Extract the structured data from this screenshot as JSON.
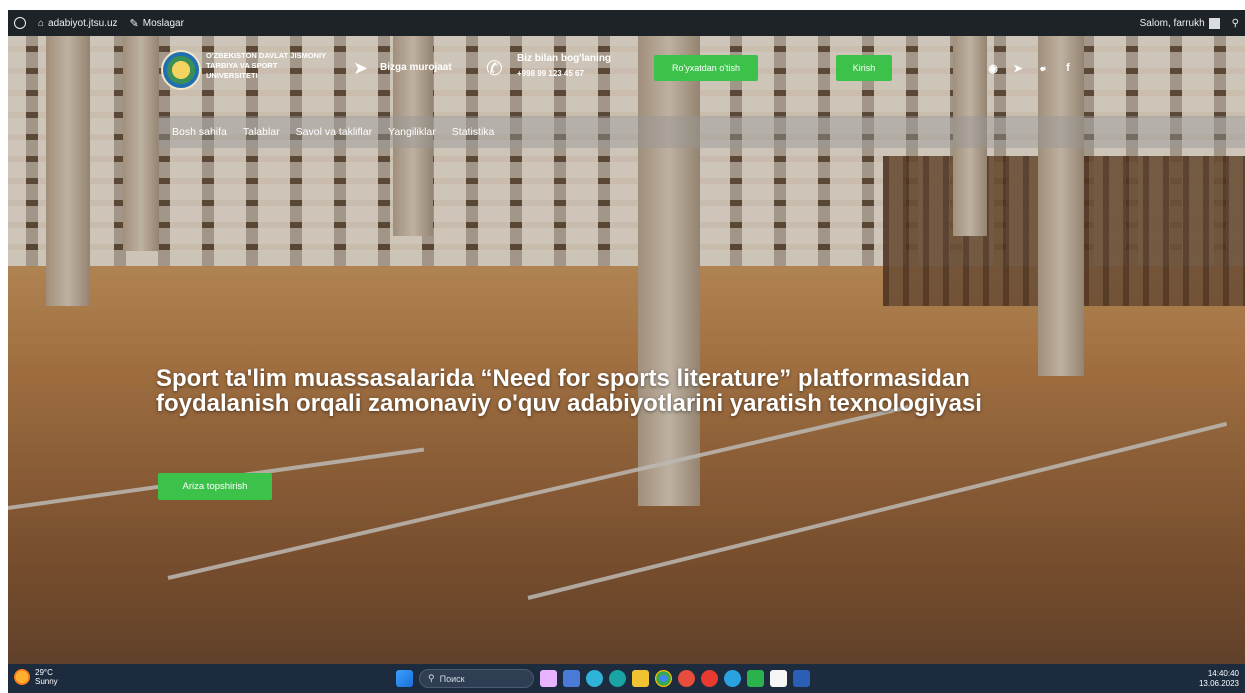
{
  "adminbar": {
    "wp_logo_icon": "wordpress-icon",
    "site_icon": "home-icon",
    "site_name": "adabiyot.jtsu.uz",
    "customize_icon": "customize-icon",
    "customize_label": "Moslagar",
    "greeting": "Salom, farrukh",
    "search_icon": "search-icon"
  },
  "header": {
    "logo_text": "O'ZBEKISTON DAVLAT JISMONIY TARBIYA VA SPORT UNIVERSITETI",
    "contact_label": "Bizga murojaat",
    "phone_label": "Biz bilan bog'laning",
    "phone_number": "+998 99 123 45 67",
    "register_button": "Ro'yxatdan o'tish",
    "login_button": "Kirish",
    "socials": [
      "instagram-icon",
      "telegram-icon",
      "twitter-icon",
      "facebook-icon"
    ]
  },
  "nav": {
    "items": [
      "Bosh sahifa",
      "Talablar",
      "Savol va takliflar",
      "Yangiliklar",
      "Statistika"
    ]
  },
  "hero": {
    "title": "Sport ta'lim muassasalarida “Need for sports literature” platformasidan foydalanish orqali zamonaviy o'quv adabiyotlarini yaratish texnologiyasi",
    "cta_button": "Ariza topshirish"
  },
  "taskbar": {
    "temperature": "29°C",
    "weather_text": "Sunny",
    "search_placeholder": "Поиск",
    "time": "14:40:40",
    "date": "13.06.2023",
    "icons": [
      "windows-start-icon",
      "search-icon",
      "task-view-icon",
      "file-explorer-icon",
      "edge-icon",
      "store-icon",
      "chrome-icon",
      "yandex-icon",
      "word-icon",
      "telegram-icon",
      "opera-icon",
      "notes-icon"
    ]
  },
  "colors": {
    "accent_green": "#3cc24a",
    "adminbar": "#1d2327",
    "taskbar": "#1c2b3e"
  }
}
